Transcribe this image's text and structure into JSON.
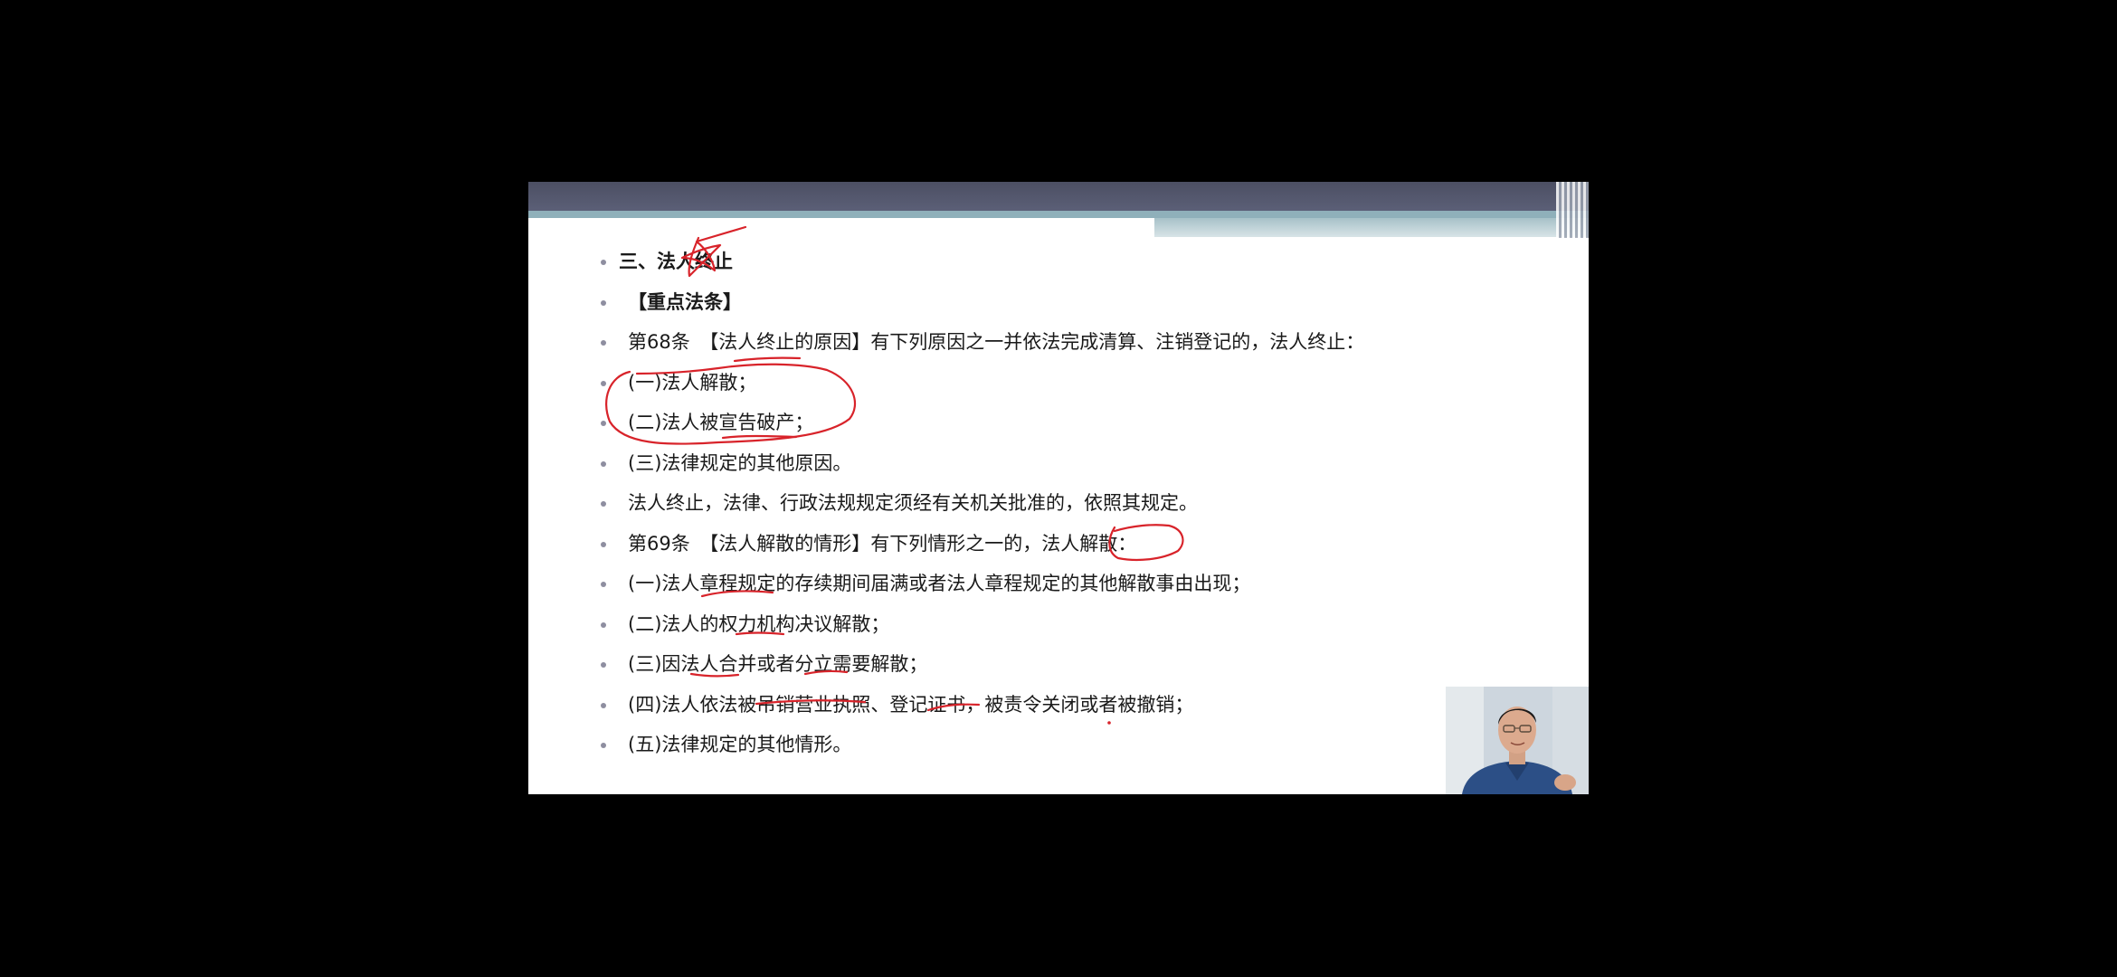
{
  "slide": {
    "lines": [
      {
        "text": "三、法人终止",
        "bold": true
      },
      {
        "text": "【重点法条】",
        "bold": true
      },
      {
        "text": "第68条　【法人终止的原因】有下列原因之一并依法完成清算、注销登记的，法人终止：",
        "bold": false
      },
      {
        "text": "(一)法人解散；",
        "bold": false
      },
      {
        "text": "(二)法人被宣告破产；",
        "bold": false
      },
      {
        "text": "(三)法律规定的其他原因。",
        "bold": false
      },
      {
        "text": "法人终止，法律、行政法规规定须经有关机关批准的，依照其规定。",
        "bold": false
      },
      {
        "text": "第69条　【法人解散的情形】有下列情形之一的，法人解散：",
        "bold": false
      },
      {
        "text": "(一)法人章程规定的存续期间届满或者法人章程规定的其他解散事由出现；",
        "bold": false
      },
      {
        "text": "(二)法人的权力机构决议解散；",
        "bold": false
      },
      {
        "text": "(三)因法人合并或者分立需要解散；",
        "bold": false
      },
      {
        "text": "(四)法人依法被吊销营业执照、登记证书，被责令关闭或者被撤销；",
        "bold": false
      },
      {
        "text": "(五)法律规定的其他情形。",
        "bold": false
      }
    ]
  },
  "colors": {
    "annotation": "#d8232a",
    "bullet": "#8e8ea0",
    "header_dark": "#4c4f63",
    "header_teal": "#8fb0ba"
  },
  "webcam": {
    "icon": "presenter-video"
  }
}
